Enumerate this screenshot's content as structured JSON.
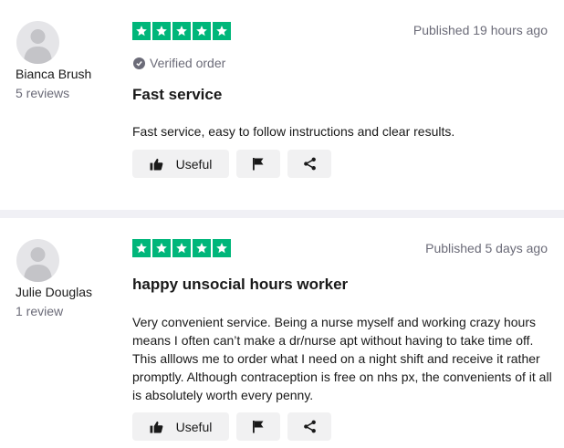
{
  "reviews": [
    {
      "reviewer_name": "Bianca Brush",
      "reviewer_reviews": "5 reviews",
      "rating": 5,
      "published": "Published 19 hours ago",
      "verified_label": "Verified order",
      "title": "Fast service",
      "body": "Fast service, easy to follow instructions and clear results.",
      "useful_label": "Useful"
    },
    {
      "reviewer_name": "Julie Douglas",
      "reviewer_reviews": "1 review",
      "rating": 5,
      "published": "Published 5 days ago",
      "title": "happy unsocial hours worker",
      "body": "Very convenient service. Being a nurse myself and working crazy hours means I often can’t make a dr/nurse apt without having to take time off. This alllows me to order what I need on a night shift and receive it rather promptly. Although contraception is free on nhs px, the convenients of it all is absolutely worth every penny.",
      "useful_label": "Useful"
    }
  ],
  "colors": {
    "star_green": "#00b67a",
    "muted_text": "#6b6b78",
    "button_bg": "#f1f1f2"
  },
  "icons": [
    "avatar-silhouette",
    "star-icon",
    "verified-check-icon",
    "thumbs-up-icon",
    "flag-icon",
    "share-icon"
  ]
}
